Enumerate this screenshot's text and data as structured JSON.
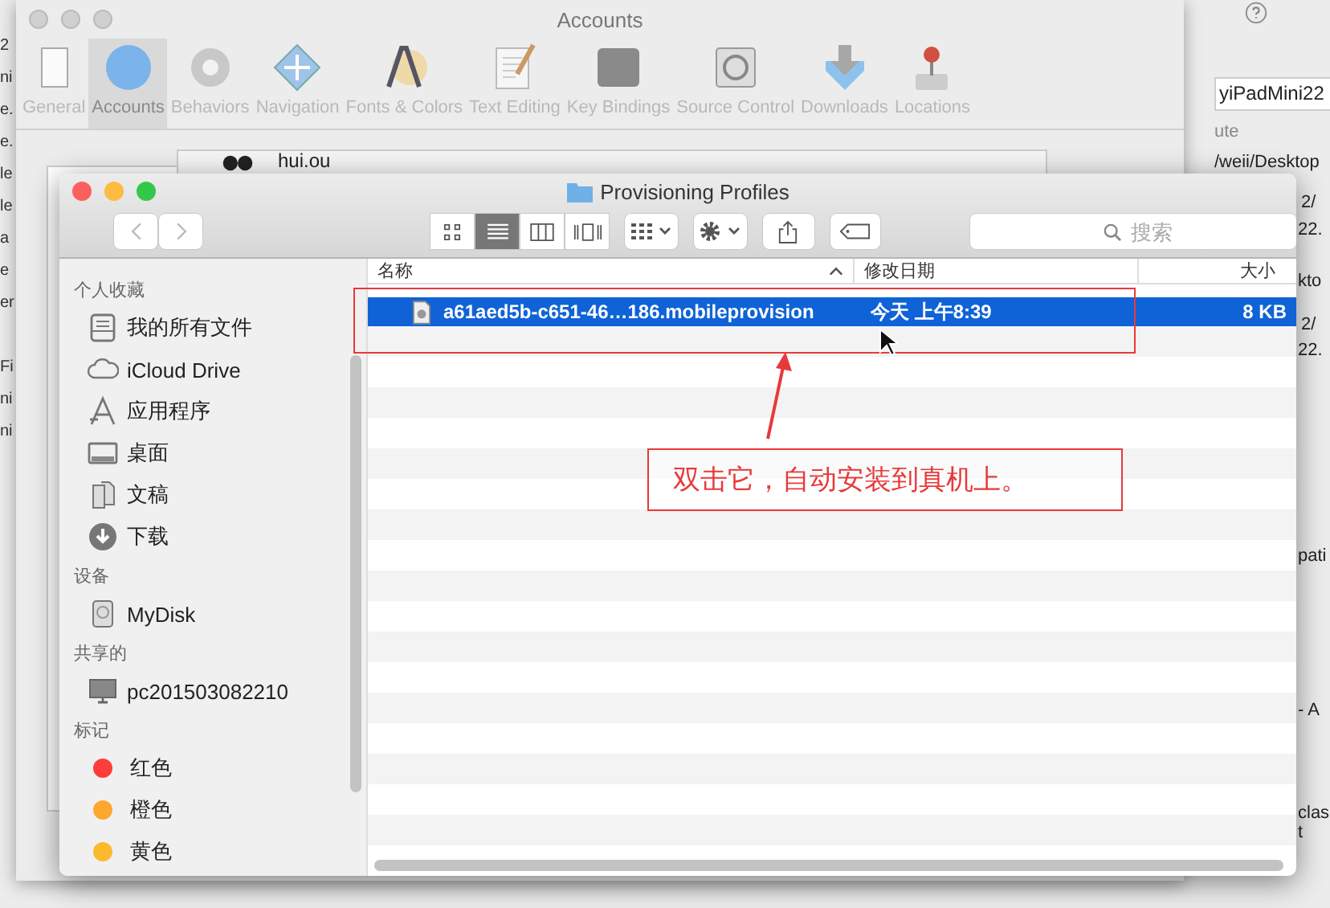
{
  "background_window": {
    "left_fragments": [
      "2",
      "ni",
      "e.",
      "e.",
      "le",
      "le",
      "a",
      "e",
      "er",
      "Fi",
      "ni",
      "ni"
    ],
    "right_fragments": [
      {
        "text": "yiPadMini22",
        "kind": "field"
      },
      {
        "text": "ute",
        "kind": "heading"
      },
      {
        "text": "/weii/Desktop",
        "kind": "text"
      },
      {
        "text": "2/",
        "kind": "text"
      },
      {
        "text": "22.",
        "kind": "text"
      },
      {
        "text": "kto",
        "kind": "text"
      },
      {
        "text": "2/",
        "kind": "text"
      },
      {
        "text": "22.",
        "kind": "text"
      },
      {
        "text": "pati",
        "kind": "text"
      },
      {
        "text": "- A",
        "kind": "text"
      },
      {
        "text": "clas",
        "kind": "text"
      },
      {
        "text": "t",
        "kind": "text"
      }
    ]
  },
  "preferences_window": {
    "title": "Accounts",
    "tabs": [
      {
        "label": "General",
        "selected": false
      },
      {
        "label": "Accounts",
        "selected": true
      },
      {
        "label": "Behaviors",
        "selected": false
      },
      {
        "label": "Navigation",
        "selected": false
      },
      {
        "label": "Fonts & Colors",
        "selected": false
      },
      {
        "label": "Text Editing",
        "selected": false
      },
      {
        "label": "Key Bindings",
        "selected": false
      },
      {
        "label": "Source Control",
        "selected": false
      },
      {
        "label": "Downloads",
        "selected": false
      },
      {
        "label": "Locations",
        "selected": false
      }
    ],
    "account_name": "hui.ou"
  },
  "finder_window": {
    "title": "Provisioning Profiles",
    "search": {
      "placeholder": "搜索"
    },
    "sidebar": [
      {
        "heading": "个人收藏",
        "items": [
          {
            "label": "我的所有文件",
            "kind": "files"
          },
          {
            "label": "iCloud Drive",
            "kind": "cloud"
          },
          {
            "label": "应用程序",
            "kind": "apps"
          },
          {
            "label": "桌面",
            "kind": "desktop"
          },
          {
            "label": "文稿",
            "kind": "documents"
          },
          {
            "label": "下载",
            "kind": "downloads"
          }
        ]
      },
      {
        "heading": "设备",
        "items": [
          {
            "label": "MyDisk",
            "kind": "disk"
          }
        ]
      },
      {
        "heading": "共享的",
        "items": [
          {
            "label": "pc201503082210",
            "kind": "computer"
          }
        ]
      },
      {
        "heading": "标记",
        "items": [
          {
            "label": "红色",
            "kind": "tag",
            "color": "#fc3d39"
          },
          {
            "label": "橙色",
            "kind": "tag",
            "color": "#fda72e"
          },
          {
            "label": "黄色",
            "kind": "tag",
            "color": "#fdb92e"
          }
        ]
      }
    ],
    "columns": [
      {
        "label": "名称",
        "sorted": true
      },
      {
        "label": "修改日期",
        "sorted": false
      },
      {
        "label": "大小",
        "sorted": false
      }
    ],
    "rows": [
      {
        "name": "a61aed5b-c651-46…186.mobileprovision",
        "date": "今天 上午8:39",
        "size": "8 KB",
        "selected": true
      }
    ]
  },
  "annotation": {
    "text": "双击它，自动安装到真机上。"
  }
}
